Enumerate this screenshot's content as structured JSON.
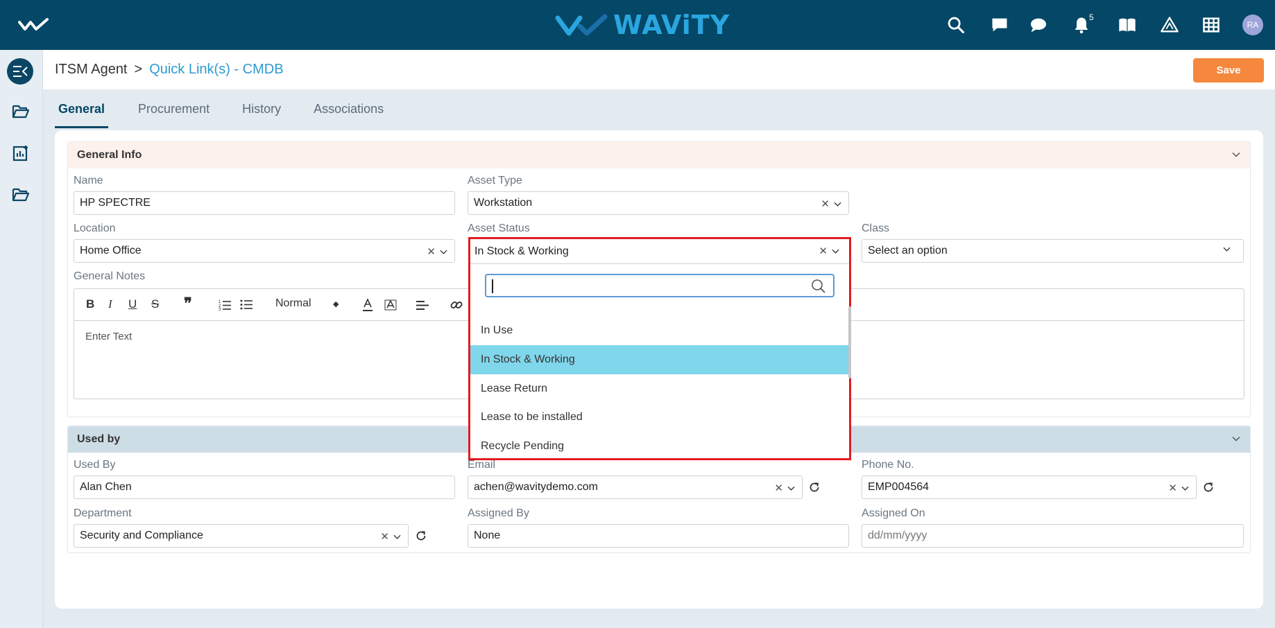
{
  "app": {
    "brand": "WAViTY",
    "notification_count": "5",
    "user_initials": "RA"
  },
  "breadcrumb": {
    "root": "ITSM Agent",
    "separator": ">",
    "current": "Quick Link(s) - CMDB"
  },
  "actions": {
    "save_label": "Save"
  },
  "tabs": [
    {
      "label": "General"
    },
    {
      "label": "Procurement"
    },
    {
      "label": "History"
    },
    {
      "label": "Associations"
    }
  ],
  "general_info": {
    "title": "General Info",
    "name_label": "Name",
    "name_value": "HP SPECTRE",
    "asset_type_label": "Asset Type",
    "asset_type_value": "Workstation",
    "location_label": "Location",
    "location_value": "Home Office",
    "asset_status_label": "Asset Status",
    "asset_status_value": "In Stock & Working",
    "class_label": "Class",
    "class_placeholder": "Select an option",
    "notes_label": "General Notes",
    "notes_placeholder": "Enter Text",
    "format_label": "Normal"
  },
  "status_dropdown": {
    "search_value": "",
    "options": [
      {
        "label": "In Use"
      },
      {
        "label": "In Stock & Working",
        "selected": true
      },
      {
        "label": "Lease Return"
      },
      {
        "label": "Lease to be installed"
      },
      {
        "label": "Recycle Pending"
      }
    ]
  },
  "used_by": {
    "title": "Used by",
    "used_by_label": "Used By",
    "used_by_value": "Alan Chen",
    "email_label": "Email",
    "email_value": "achen@wavitydemo.com",
    "phone_label": "Phone No.",
    "phone_value": "EMP004564",
    "department_label": "Department",
    "department_value": "Security and Compliance",
    "assigned_by_label": "Assigned By",
    "assigned_by_value": "None",
    "assigned_on_label": "Assigned On",
    "assigned_on_placeholder": "dd/mm/yyyy"
  },
  "colors": {
    "topbar": "#044766",
    "accent": "#2aa6e0",
    "save": "#f5883c",
    "highlight": "#80d6ea",
    "dropdown_border": "#e21b22"
  }
}
